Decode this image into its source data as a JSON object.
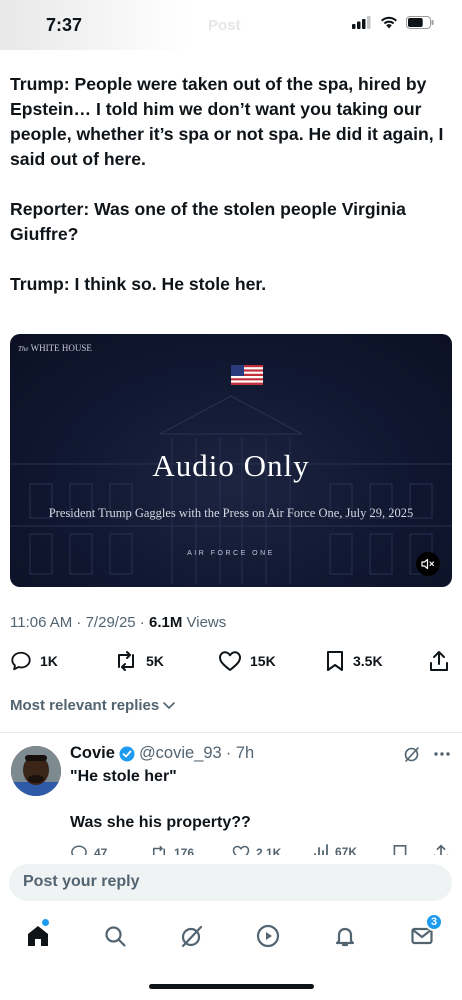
{
  "status_bar": {
    "time": "7:37",
    "ghost_header": "Post",
    "battery_level": 0.7
  },
  "post": {
    "paragraphs": [
      "Trump: People were taken out of the spa, hired by Epstein… I told him we don’t want you taking our people, whether it’s spa or not spa. He did it again, I said out of here.",
      "Reporter: Was one of the stolen people Virginia Giuffre?",
      "Trump: I think so. He stole her."
    ],
    "media": {
      "logo_prefix": "The",
      "logo_text": "WHITE HOUSE",
      "title": "Audio Only",
      "subtitle": "President Trump Gaggles with the Press on Air Force One, July 29, 2025",
      "tag": "AIR FORCE ONE",
      "mute_icon": "speaker-muted-icon"
    },
    "timestamp": "11:06 AM · 7/29/25 · ",
    "views_count": "6.1M",
    "views_label": " Views",
    "actions": {
      "replies": "1K",
      "reposts": "5K",
      "likes": "15K",
      "bookmarks": "3.5K"
    }
  },
  "replies_filter": {
    "label": "Most relevant replies"
  },
  "reply": {
    "name": "Covie",
    "handle": "@covie_93",
    "time": "· 7h",
    "line1": "\"He stole her\"",
    "line2": "Was she his property??",
    "counts": {
      "replies": "47",
      "reposts": "176",
      "likes": "2.1K",
      "views": "67K"
    }
  },
  "composer": {
    "placeholder": "Post your reply"
  },
  "tabbar": {
    "items": [
      "home-icon",
      "search-icon",
      "grok-icon",
      "video-icon",
      "notifications-icon",
      "messages-icon"
    ],
    "messages_badge": "3"
  },
  "colors": {
    "accent": "#1d9bf0",
    "text": "#0f1419",
    "muted": "#536471",
    "media_bg": "#101730"
  }
}
